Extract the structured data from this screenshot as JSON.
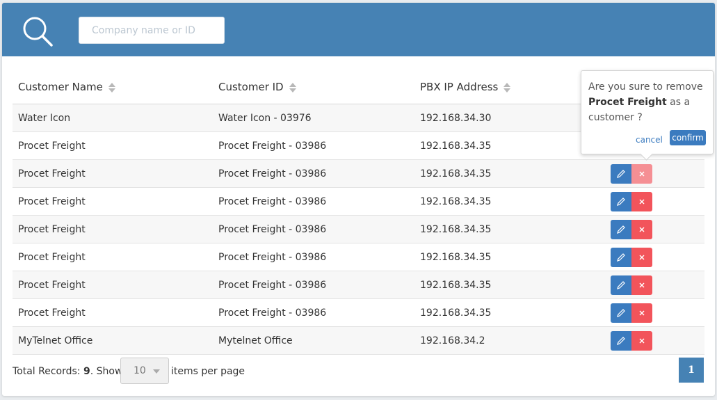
{
  "search": {
    "placeholder": "Company name or ID"
  },
  "table": {
    "columns": [
      "Customer Name",
      "Customer ID",
      "PBX IP Address"
    ],
    "rows": [
      {
        "name": "Water Icon",
        "id": "Water Icon - 03976",
        "ip": "192.168.34.30"
      },
      {
        "name": "Procet Freight",
        "id": "Procet Freight - 03986",
        "ip": "192.168.34.35"
      },
      {
        "name": "Procet Freight",
        "id": "Procet Freight - 03986",
        "ip": "192.168.34.35"
      },
      {
        "name": "Procet Freight",
        "id": "Procet Freight - 03986",
        "ip": "192.168.34.35"
      },
      {
        "name": "Procet Freight",
        "id": "Procet Freight - 03986",
        "ip": "192.168.34.35"
      },
      {
        "name": "Procet Freight",
        "id": "Procet Freight - 03986",
        "ip": "192.168.34.35"
      },
      {
        "name": "Procet Freight",
        "id": "Procet Freight - 03986",
        "ip": "192.168.34.35"
      },
      {
        "name": "Procet Freight",
        "id": "Procet Freight - 03986",
        "ip": "192.168.34.35"
      },
      {
        "name": "MyTelnet Office",
        "id": "Mytelnet Office",
        "ip": "192.168.34.2"
      }
    ]
  },
  "footer": {
    "total_label": "Total Records: ",
    "total_count": "9",
    "show_label": ".  Show",
    "per_page_value": "10",
    "per_page_label": "items per page",
    "current_page": "1"
  },
  "popover": {
    "line_prefix": "Are you sure to remove ",
    "customer": "Procet Freight",
    "line_suffix": " as a customer ?",
    "cancel_label": "cancel",
    "confirm_label": "confirm"
  },
  "icons": {
    "search": "search-icon",
    "edit": "pencil-icon",
    "delete": "close-icon",
    "sort": "sort-icon",
    "dropdown": "chevron-down-icon"
  },
  "colors": {
    "header_bg": "#4682b4",
    "edit_button": "#3b7bbf",
    "delete_button": "#f2545b"
  }
}
